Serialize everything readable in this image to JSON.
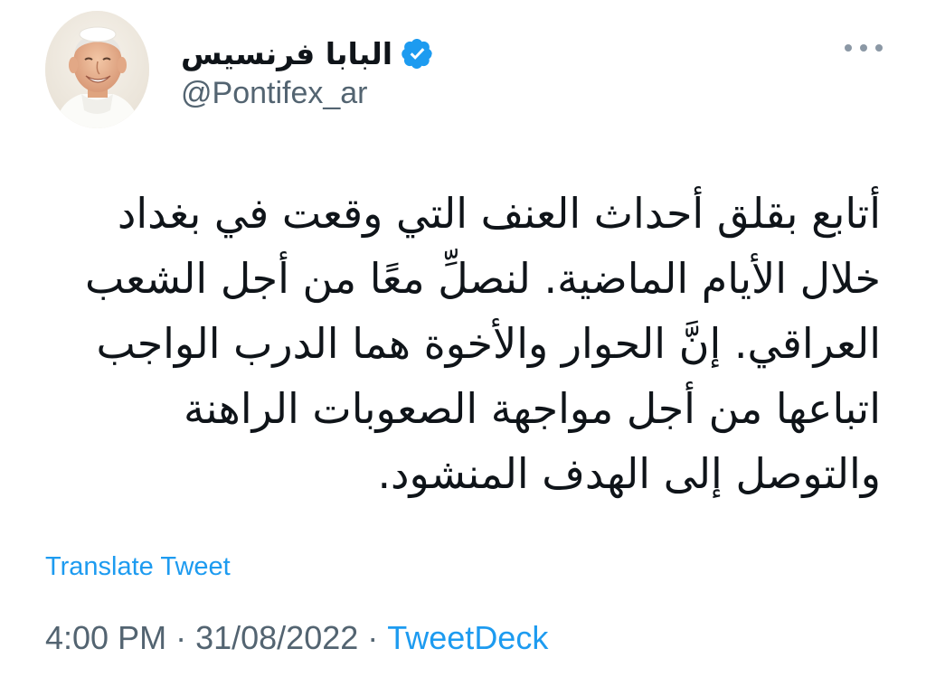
{
  "author": {
    "display_name": "البابا فرنسيس",
    "handle": "@Pontifex_ar",
    "verified": true,
    "avatar_icon": "pope-portrait-avatar"
  },
  "tweet": {
    "text": "أتابع بقلق أحداث العنف التي وقعت في بغداد خلال الأيام الماضية. لنصلِّ معًا من أجل الشعب العراقي. إنَّ الحوار والأخوة هما الدرب الواجب اتباعها من أجل مواجهة الصعوبات الراهنة والتوصل إلى الهدف المنشود.",
    "translate_label": "Translate Tweet",
    "time": "4:00 PM",
    "separator": "·",
    "date": "31/08/2022",
    "source": "TweetDeck"
  },
  "colors": {
    "accent": "#1d9bf0",
    "muted_text": "#536471",
    "primary_text": "#0f1419",
    "verified_badge": "#1d9bf0"
  },
  "icons": {
    "verified": "verified-badge-icon",
    "more": "more-options-icon"
  }
}
